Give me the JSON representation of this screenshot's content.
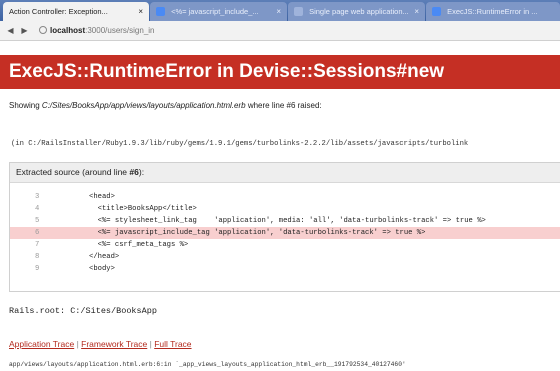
{
  "browser": {
    "tabs": [
      {
        "label": "Action Controller: Exception...",
        "close": "×",
        "active": true,
        "favicon_color": "#f2f2f2"
      },
      {
        "label": "<%= javascript_include_...",
        "close": "×",
        "active": false,
        "favicon_color": "#4a8af4"
      },
      {
        "label": "Single page web application...",
        "close": "×",
        "active": false,
        "favicon_color": "#9fb3db"
      },
      {
        "label": "ExecJS::RuntimeError in ...",
        "close": "",
        "active": false,
        "favicon_color": "#4a8af4"
      }
    ],
    "back_icon": "◀",
    "forward_icon": "▶",
    "url_host": "localhost",
    "url_path": ":3000/users/sign_in"
  },
  "error": {
    "title": "ExecJS::RuntimeError in Devise::Sessions#new",
    "showing_prefix": "Showing ",
    "showing_path": "C:/Sites/BooksApp/app/views/layouts/application.html.erb",
    "showing_suffix": " where line #6 raised:",
    "trace_line": "(in C:/RailsInstaller/Ruby1.9.3/lib/ruby/gems/1.9.1/gems/turbolinks-2.2.2/lib/assets/javascripts/turbolink",
    "extracted_header": "Extracted source (around line ",
    "extracted_line": "#6",
    "extracted_close": "):"
  },
  "source_lines": [
    {
      "num": "3",
      "code": "<head>",
      "highlight": false
    },
    {
      "num": "4",
      "code": "  <title>BooksApp</title>",
      "highlight": false
    },
    {
      "num": "5",
      "code": "  <%= stylesheet_link_tag    'application', media: 'all', 'data-turbolinks-track' => true %>",
      "highlight": false
    },
    {
      "num": "6",
      "code": "  <%= javascript_include_tag 'application', 'data-turbolinks-track' => true %>",
      "highlight": true
    },
    {
      "num": "7",
      "code": "  <%= csrf_meta_tags %>",
      "highlight": false
    },
    {
      "num": "8",
      "code": "</head>",
      "highlight": false
    },
    {
      "num": "9",
      "code": "<body>",
      "highlight": false
    }
  ],
  "rails_root": "Rails.root: C:/Sites/BooksApp",
  "links": {
    "application_trace": "Application Trace",
    "framework_trace": "Framework Trace",
    "full_trace": "Full Trace",
    "separator": " | "
  },
  "app_trace_line": "app/views/layouts/application.html.erb:6:in `_app_views_layouts_application_html_erb__191792534_40127460'",
  "colors": {
    "banner": "#c52f24",
    "highlight_row": "#f8cfcf",
    "link": "#b32a1e"
  }
}
